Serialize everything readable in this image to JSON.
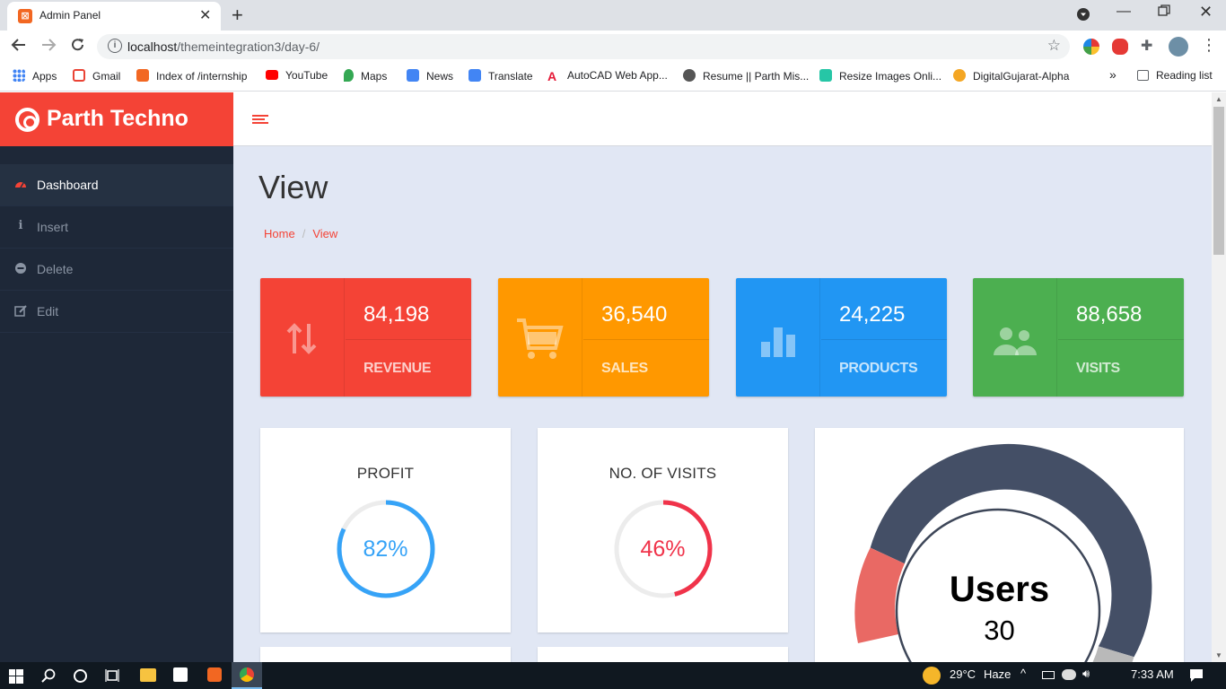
{
  "browser": {
    "tab_title": "Admin Panel",
    "url_host": "localhost",
    "url_path": "/themeintegration3/day-6/",
    "bookmarks": [
      "Apps",
      "Gmail",
      "Index of /internship",
      "YouTube",
      "Maps",
      "News",
      "Translate",
      "AutoCAD Web App...",
      "Resume || Parth Mis...",
      "Resize Images Onli...",
      "DigitalGujarat-Alpha"
    ],
    "more": "»",
    "reading_list": "Reading list"
  },
  "sidebar": {
    "brand": "Parth Techno",
    "items": [
      {
        "label": "Dashboard",
        "icon": "dashboard-icon"
      },
      {
        "label": "Insert",
        "icon": "info-icon"
      },
      {
        "label": "Delete",
        "icon": "minus-circle-icon"
      },
      {
        "label": "Edit",
        "icon": "edit-icon"
      }
    ]
  },
  "main": {
    "title": "View",
    "breadcrumb": {
      "home": "Home",
      "current": "View"
    },
    "stats": [
      {
        "value": "84,198",
        "label": "REVENUE",
        "color": "#f44336",
        "icon": "arrows-updown-icon"
      },
      {
        "value": "36,540",
        "label": "SALES",
        "color": "#ff9800",
        "icon": "cart-icon"
      },
      {
        "value": "24,225",
        "label": "PRODUCTS",
        "color": "#2196f3",
        "icon": "bar-chart-icon"
      },
      {
        "value": "88,658",
        "label": "VISITS",
        "color": "#4caf50",
        "icon": "users-icon"
      }
    ],
    "profit": {
      "title": "PROFIT",
      "value": "82%",
      "percent": 82,
      "color": "#36a3f7"
    },
    "visits": {
      "title": "NO. OF VISITS",
      "value": "46%",
      "percent": 46,
      "color": "#f0334a"
    },
    "users": {
      "title": "Users",
      "value": "30"
    }
  },
  "taskbar": {
    "weather": "29°C",
    "condition": "Haze",
    "time": "7:33 AM"
  }
}
